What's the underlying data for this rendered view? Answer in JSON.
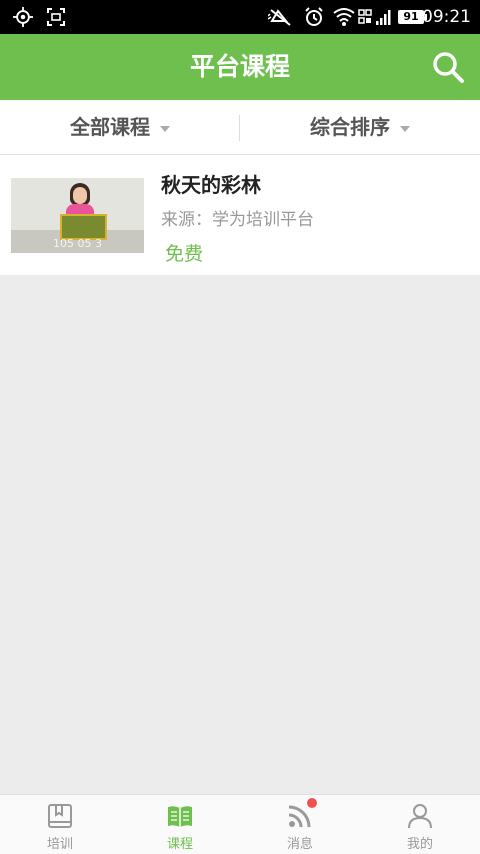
{
  "status_bar": {
    "time": "09:21",
    "battery": "91"
  },
  "header": {
    "title": "平台课程"
  },
  "filters": [
    {
      "label": "全部课程"
    },
    {
      "label": "综合排序"
    }
  ],
  "courses": [
    {
      "title": "秋天的彩林",
      "source": "来源：学为培训平台",
      "price": "免费",
      "thumbnail_caption": "105 05 3"
    }
  ],
  "tabs": [
    {
      "label": "培训",
      "icon": "book-icon",
      "active": false
    },
    {
      "label": "课程",
      "icon": "open-book-icon",
      "active": true
    },
    {
      "label": "消息",
      "icon": "rss-icon",
      "active": false,
      "badge": true
    },
    {
      "label": "我的",
      "icon": "person-icon",
      "active": false
    }
  ],
  "colors": {
    "accent": "#6fbf4f",
    "badge": "#f05050"
  }
}
